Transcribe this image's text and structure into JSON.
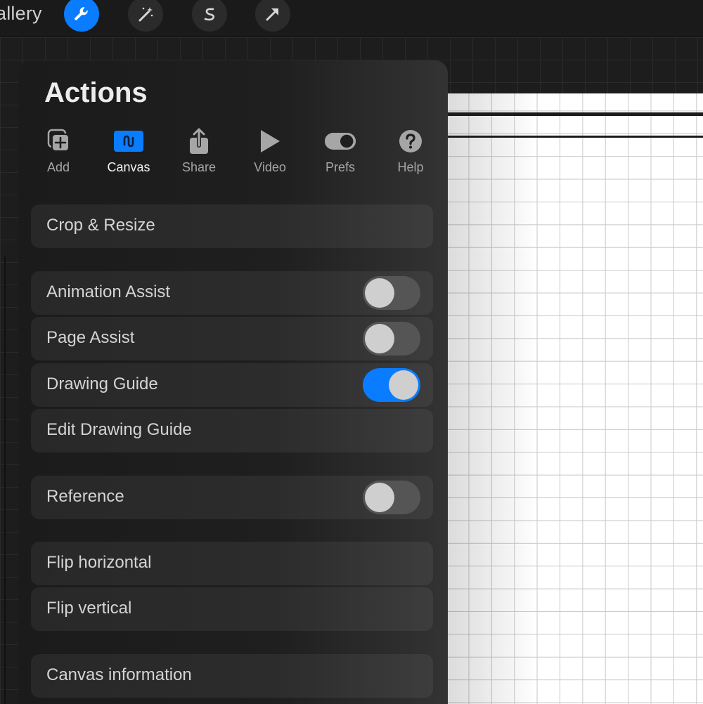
{
  "topbar": {
    "gallery_label": "allery",
    "tools": [
      {
        "icon": "wrench-icon",
        "active": true
      },
      {
        "icon": "magic-wand-icon",
        "active": false
      },
      {
        "icon": "selection-s-icon",
        "active": false
      },
      {
        "icon": "arrow-transform-icon",
        "active": false
      }
    ]
  },
  "panel": {
    "title": "Actions",
    "tabs": [
      {
        "label": "Add",
        "icon": "add-layer-icon"
      },
      {
        "label": "Canvas",
        "icon": "canvas-icon",
        "active": true
      },
      {
        "label": "Share",
        "icon": "share-icon"
      },
      {
        "label": "Video",
        "icon": "play-icon"
      },
      {
        "label": "Prefs",
        "icon": "toggle-icon"
      },
      {
        "label": "Help",
        "icon": "help-icon"
      }
    ],
    "rows": {
      "crop_resize": "Crop & Resize",
      "animation_assist": "Animation Assist",
      "page_assist": "Page Assist",
      "drawing_guide": "Drawing Guide",
      "edit_drawing_guide": "Edit Drawing Guide",
      "reference": "Reference",
      "flip_horizontal": "Flip horizontal",
      "flip_vertical": "Flip vertical",
      "canvas_information": "Canvas information"
    },
    "toggles": {
      "animation_assist": false,
      "page_assist": false,
      "drawing_guide": true,
      "reference": false
    }
  },
  "colors": {
    "accent": "#0a7cff",
    "panel_bg": "#1f1f1f",
    "row_text": "#d4d4d4"
  }
}
